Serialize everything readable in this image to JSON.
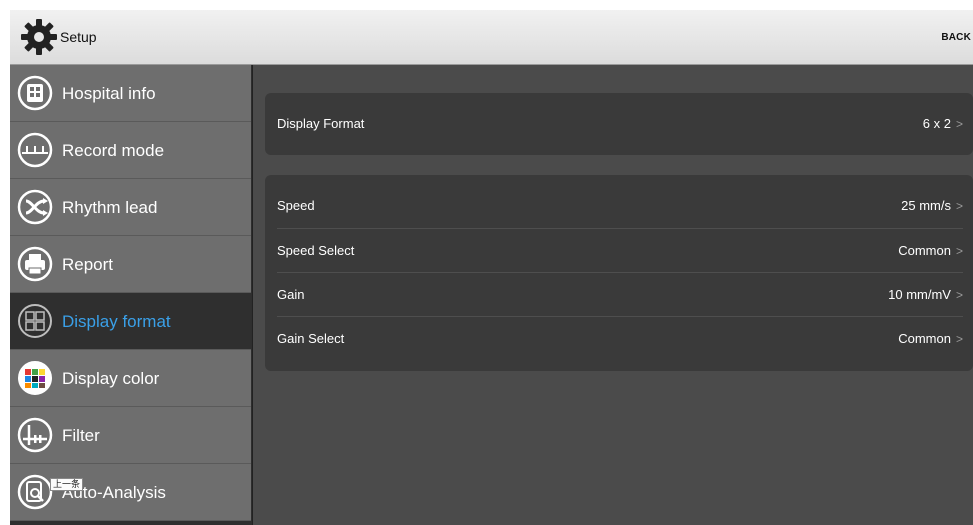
{
  "header": {
    "title": "Setup",
    "back_label": "BACK"
  },
  "sidebar": {
    "items": [
      {
        "label": "Hospital info",
        "icon": "hospital-icon",
        "active": false
      },
      {
        "label": "Record mode",
        "icon": "record-wave-icon",
        "active": false
      },
      {
        "label": "Rhythm lead",
        "icon": "shuffle-icon",
        "active": false
      },
      {
        "label": "Report",
        "icon": "printer-icon",
        "active": false
      },
      {
        "label": "Display format",
        "icon": "grid-icon",
        "active": true
      },
      {
        "label": "Display color",
        "icon": "color-palette-icon",
        "active": false
      },
      {
        "label": "Filter",
        "icon": "filter-icon",
        "active": false
      },
      {
        "label": "Auto-Analysis",
        "icon": "magnifier-icon",
        "active": false
      }
    ],
    "tooltip": "上一条"
  },
  "settings": {
    "display_format": {
      "label": "Display Format",
      "value": "6 x 2"
    },
    "speed": {
      "label": "Speed",
      "value": "25 mm/s"
    },
    "speed_select": {
      "label": "Speed Select",
      "value": "Common"
    },
    "gain": {
      "label": "Gain",
      "value": "10 mm/mV"
    },
    "gain_select": {
      "label": "Gain Select",
      "value": "Common"
    },
    "chevron": ">"
  },
  "colors": {
    "accent": "#3aa0e8",
    "sidebar_bg": "#6e6e6e",
    "content_bg": "#4b4b4b"
  }
}
